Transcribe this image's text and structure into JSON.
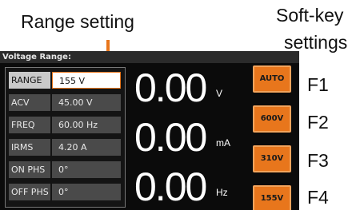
{
  "annotations": {
    "range_setting": "Range setting",
    "softkey_line1": "Soft-key",
    "softkey_line2": "settings"
  },
  "title": "Voltage Range:",
  "params": [
    {
      "label": "RANGE",
      "value": "155 V",
      "active": true
    },
    {
      "label": "ACV",
      "value": "45.00 V"
    },
    {
      "label": "FREQ",
      "value": "60.00 Hz"
    },
    {
      "label": "IRMS",
      "value": "4.20 A"
    },
    {
      "label": "ON PHS",
      "value": "0°"
    },
    {
      "label": "OFF PHS",
      "value": "0°"
    }
  ],
  "measurements": [
    {
      "value": "0.00",
      "unit": "V"
    },
    {
      "value": "0.00",
      "unit": "mA"
    },
    {
      "value": "0.00",
      "unit": "Hz"
    }
  ],
  "softkeys": [
    {
      "label": "AUTO",
      "fkey": "F1"
    },
    {
      "label": "600V",
      "fkey": "F2"
    },
    {
      "label": "310V",
      "fkey": "F3"
    },
    {
      "label": "155V",
      "fkey": "F4"
    }
  ],
  "colors": {
    "accent": "#e8761c",
    "screen_bg": "#0b0b0b"
  }
}
